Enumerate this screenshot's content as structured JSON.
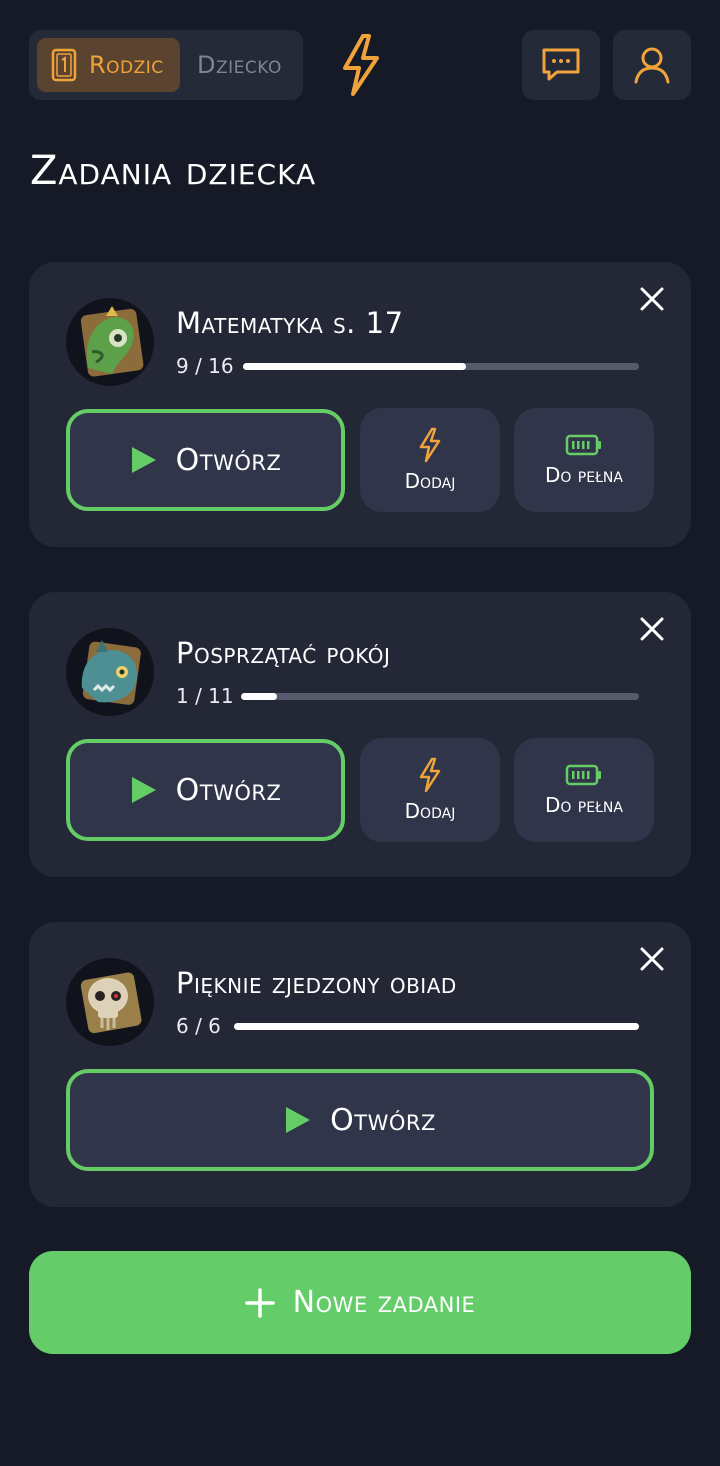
{
  "header": {
    "mode_active": "Rodzic",
    "mode_inactive": "Dziecko",
    "logo_icon": "lightning-bolt-icon",
    "chat_icon": "chat-icon",
    "profile_icon": "user-icon",
    "accent": "#f0a33a"
  },
  "page_title": "Zadania dziecka",
  "tasks": [
    {
      "title": "Matematyka s. 17",
      "count": "9 / 16",
      "progress": 0.5625,
      "avatar": "green-lizard-monster-avatar",
      "open_label": "Otwórz",
      "add_label": "Dodaj",
      "fill_label": "Do pełna"
    },
    {
      "title": "Posprzątać pokój",
      "count": "1 / 11",
      "progress": 0.09,
      "avatar": "blue-fish-monster-avatar",
      "open_label": "Otwórz",
      "add_label": "Dodaj",
      "fill_label": "Do pełna"
    },
    {
      "title": "Pięknie zjedzony obiad",
      "count": "6 / 6",
      "progress": 1.0,
      "avatar": "skull-monster-avatar",
      "open_label": "Otwórz"
    }
  ],
  "new_task_label": "Nowe zadanie",
  "colors": {
    "background": "#161a26",
    "card": "#232736",
    "green": "#64cd65",
    "orange": "#f0a33a"
  }
}
